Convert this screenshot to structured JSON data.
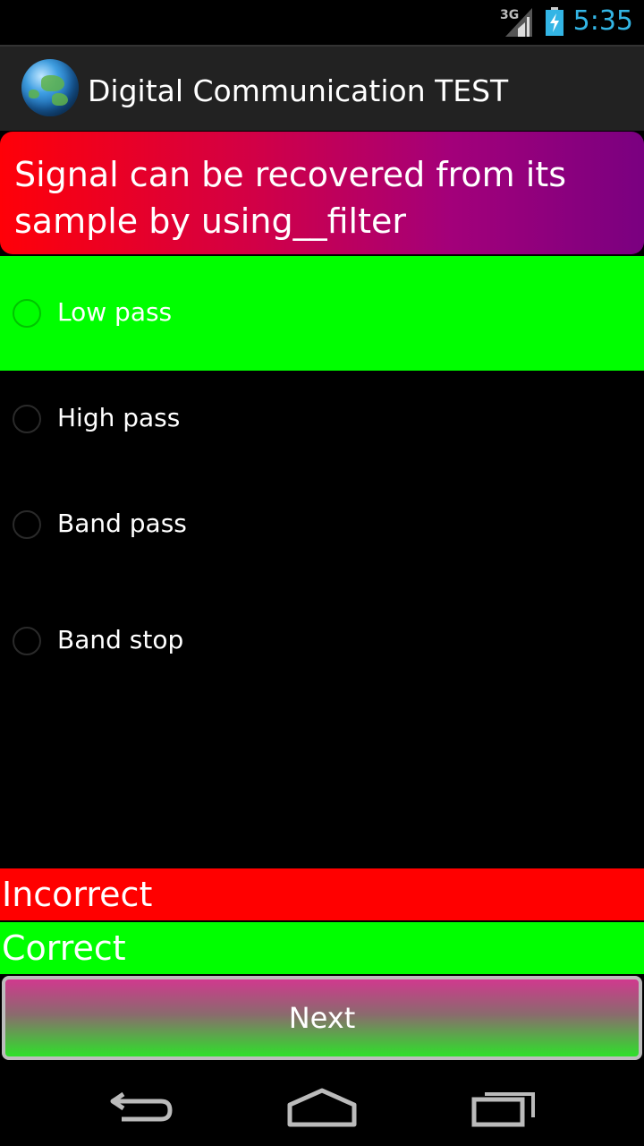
{
  "status": {
    "time": "5:35",
    "network": "3G"
  },
  "app": {
    "title": "Digital Communication TEST"
  },
  "question": {
    "text": "Signal can be recovered from its sample by using__filter"
  },
  "options": [
    {
      "label": "Low pass",
      "selected": true
    },
    {
      "label": "High pass",
      "selected": false
    },
    {
      "label": "Band pass",
      "selected": false
    },
    {
      "label": "Band stop",
      "selected": false
    }
  ],
  "results": {
    "incorrect": "Incorrect",
    "correct": "Correct"
  },
  "buttons": {
    "next": "Next"
  },
  "colors": {
    "selected": "#00ff00",
    "incorrect": "#ff0000",
    "correct": "#00ff00",
    "clock": "#33b5e5"
  },
  "icons": [
    "signal-icon",
    "battery-charging-icon",
    "globe-icon",
    "back-icon",
    "home-icon",
    "recent-apps-icon"
  ]
}
